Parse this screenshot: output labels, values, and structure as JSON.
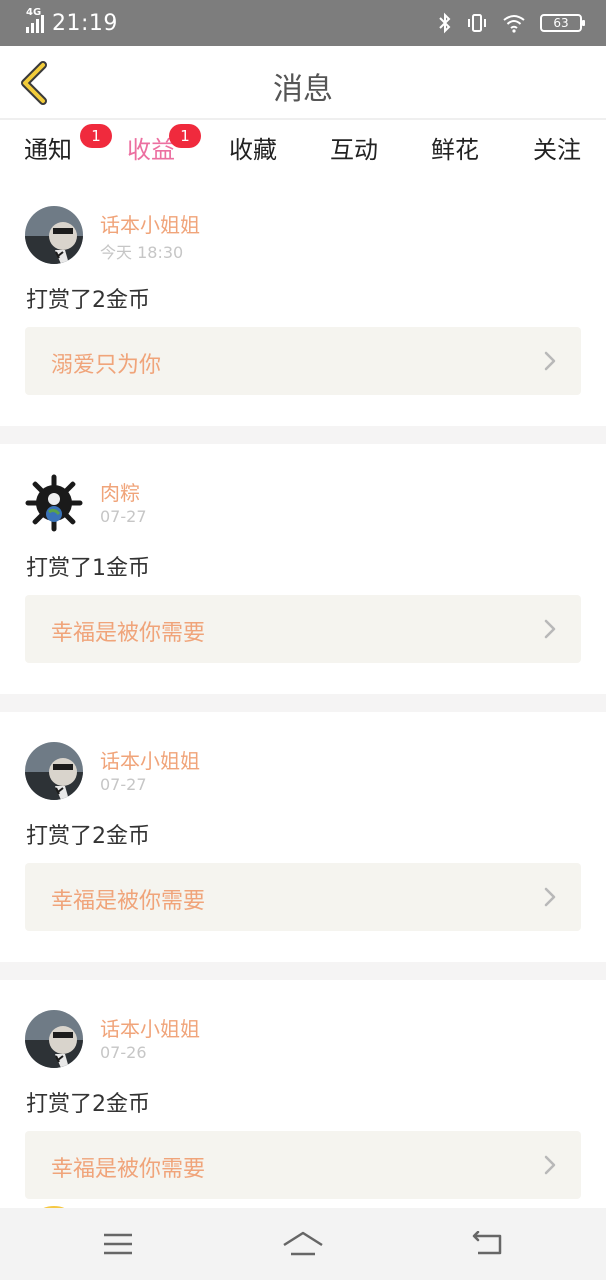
{
  "status_bar": {
    "network": "4G",
    "time": "21:19",
    "battery": "63"
  },
  "header": {
    "title": "消息"
  },
  "tabs": [
    {
      "label": "通知",
      "badge": "1",
      "active": false
    },
    {
      "label": "收益",
      "badge": "1",
      "active": true
    },
    {
      "label": "收藏",
      "badge": "",
      "active": false
    },
    {
      "label": "互动",
      "badge": "",
      "active": false
    },
    {
      "label": "鲜花",
      "badge": "",
      "active": false
    },
    {
      "label": "关注",
      "badge": "",
      "active": false
    }
  ],
  "messages": [
    {
      "user": "话本小姐姐",
      "time": "今天 18:30",
      "action": "打赏了2金币",
      "ref": "溺爱只为你"
    },
    {
      "user": "肉粽",
      "time": "07-27",
      "action": "打赏了1金币",
      "ref": "幸福是被你需要"
    },
    {
      "user": "话本小姐姐",
      "time": "07-27",
      "action": "打赏了2金币",
      "ref": "幸福是被你需要"
    },
    {
      "user": "话本小姐姐",
      "time": "07-26",
      "action": "打赏了2金币",
      "ref": "幸福是被你需要"
    }
  ],
  "colors": {
    "accent": "#ec6fa0",
    "username": "#f0a47a",
    "badge": "#f02a3d",
    "ref_bg": "#f5f4ef"
  },
  "icons": {
    "back": "chevron-left-icon",
    "chevron": "chevron-right-icon",
    "menu": "menu-icon",
    "home": "home-icon",
    "return": "back-nav-icon"
  }
}
